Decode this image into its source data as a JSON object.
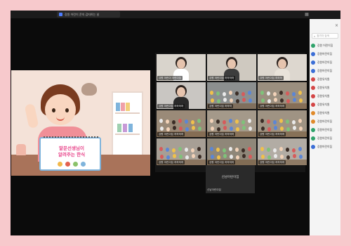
{
  "window": {
    "tab_title": "강원 어린이 쿤의 감지하는 날",
    "toolbar_icon": "grid-icon"
  },
  "shared_slide": {
    "card_title_line1": "말문선생님이",
    "card_title_line2": "알려주는 한식"
  },
  "video_tiles": [
    {
      "name": "강원 어린이 어린이집"
    },
    {
      "name": "강원 어린이집 하하하하"
    },
    {
      "name": "강원 어린이집 하하하"
    },
    {
      "name": "강원 어린이집 하하하하"
    },
    {
      "name": "강원 어린이집 하하하"
    },
    {
      "name": "강원 어린이집 하하하하"
    },
    {
      "name": "강원 어린이집 하하하하"
    },
    {
      "name": "강원 어린이집 하하하하"
    },
    {
      "name": "강원 어린이집 하하하하"
    },
    {
      "name": "강원 어린이집 하하하하"
    },
    {
      "name": "강원 어린이집 하하하하"
    },
    {
      "name": "강원 어린이집 하하하하"
    }
  ],
  "empty_tile": {
    "center_name": "신남어린이집",
    "corner_name": "신남어린이집"
  },
  "participants": {
    "search_placeholder": "참가자 검색",
    "items": [
      {
        "name": "강원 어린이집",
        "color": "#2fa36b"
      },
      {
        "name": "강원어린이집",
        "color": "#3b6ed6"
      },
      {
        "name": "강원어린이집",
        "color": "#3b6ed6"
      },
      {
        "name": "강원어린이집",
        "color": "#3b6ed6"
      },
      {
        "name": "강원유치원",
        "color": "#d44646"
      },
      {
        "name": "강원유치원",
        "color": "#d44646"
      },
      {
        "name": "강원유치원",
        "color": "#d44646"
      },
      {
        "name": "강원유치원",
        "color": "#d44646"
      },
      {
        "name": "강원유치원",
        "color": "#e08a2a"
      },
      {
        "name": "강원어린이집",
        "color": "#e08a2a"
      },
      {
        "name": "강원어린이집",
        "color": "#2fa36b"
      },
      {
        "name": "강원어린이집",
        "color": "#2fa36b"
      },
      {
        "name": "강원어린이집",
        "color": "#3b6ed6"
      }
    ],
    "bottom_button": "초대",
    "info_icon": "info-icon"
  }
}
